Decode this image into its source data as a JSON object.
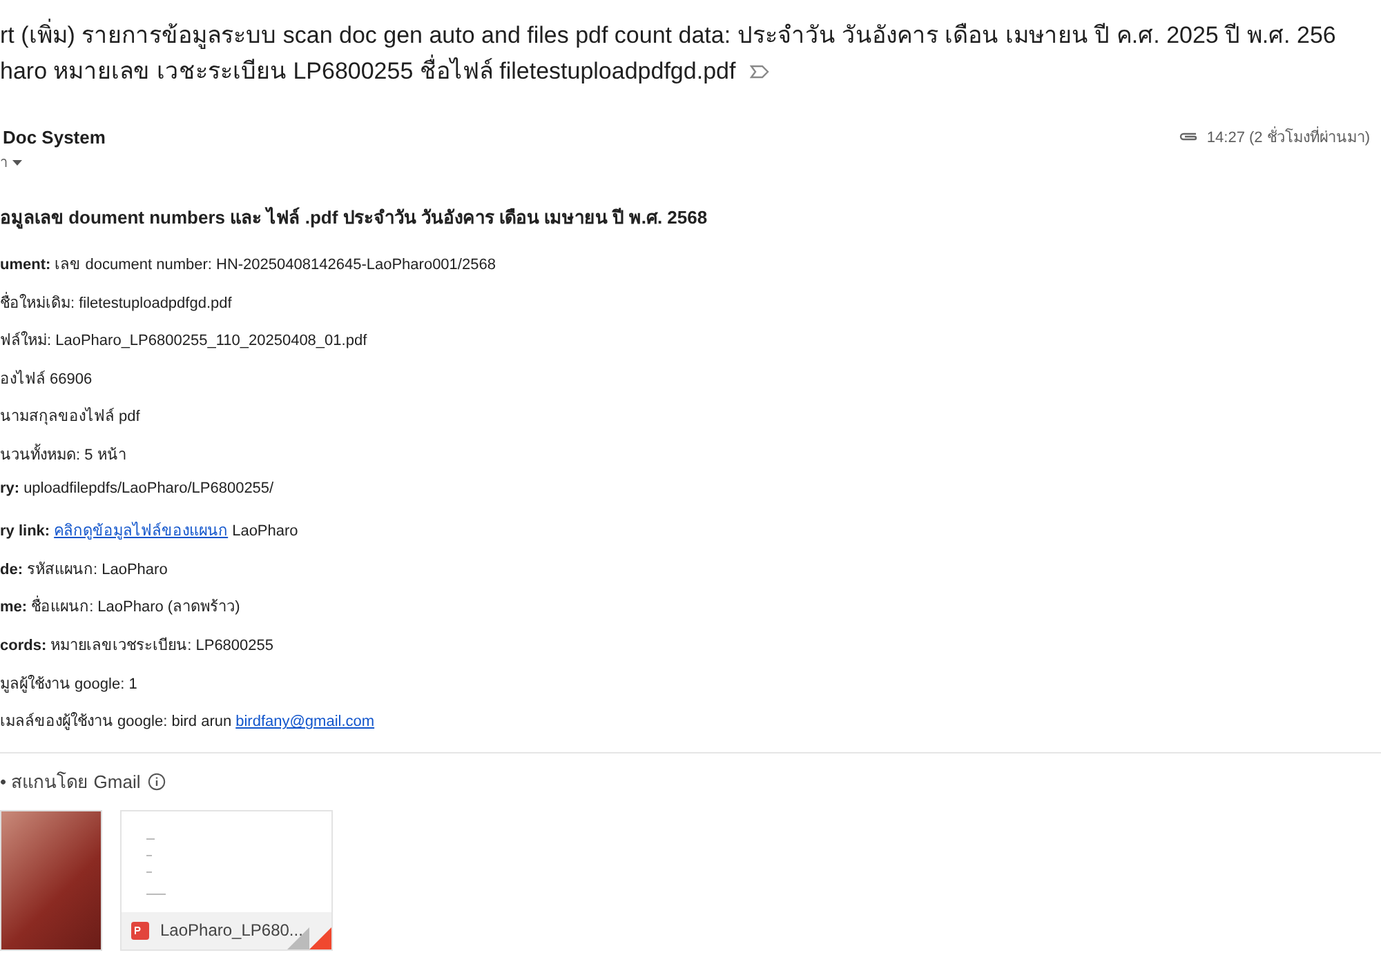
{
  "subject": {
    "lines": [
      "rt (เพิ่ม) รายการข้อมูลระบบ scan doc gen auto and files pdf count data: ประจำวัน วันอังคาร เดือน เมษายน ปี ค.ศ. 2025 ปี พ.ศ. 256",
      "haro หมายเลข เวชะระเบียน LP6800255 ชื่อไฟล์ filetestuploadpdfgd.pdf"
    ],
    "important": false
  },
  "sender": {
    "name": "Doc System",
    "recipient": "า"
  },
  "time": "14:27 (2 ชั่วโมงที่ผ่านมา)",
  "body": {
    "heading": "อมูลเลข doument numbers และ ไฟล์ .pdf ประจำวัน วันอังคาร เดือน เมษายน ปี พ.ศ. 2568",
    "rows": [
      {
        "label": "ument:",
        "value": "เลข document number: HN-20250408142645-LaoPharo001/2568"
      },
      {
        "value": "ชื่อใหม่เดิม: filetestuploadpdfgd.pdf"
      },
      {
        "value": "ฟล์ใหม่: LaoPharo_LP6800255_110_20250408_01.pdf"
      },
      {
        "value": "องไฟล์ 66906"
      },
      {
        "value": "นามสกุลของไฟล์ pdf"
      },
      {
        "value": "นวนทั้งหมด: 5 หน้า"
      },
      {
        "label": "ry:",
        "value": "uploadfilepdfs/LaoPharo/LP6800255/"
      },
      {
        "label": "ry link:",
        "link": "คลิกดูข้อมูลไฟล์ของแผนก",
        "after": "LaoPharo"
      },
      {
        "label": "de:",
        "value": "รหัสแผนก: LaoPharo"
      },
      {
        "label": "me:",
        "value": "ชื่อแผนก: LaoPharo (ลาดพร้าว)"
      },
      {
        "label": "cords:",
        "value": "หมายเลขเวชระเบียน: LP6800255"
      },
      {
        "value": "มูลผู้ใช้งาน google: 1"
      },
      {
        "value": "เมลล์ของผู้ใช้งาน google: bird arun",
        "link": "birdfany@gmail.com"
      }
    ]
  },
  "attachments": {
    "label": "• สแกนโดย Gmail",
    "items": [
      {
        "kind": "image"
      },
      {
        "kind": "pdf",
        "name": "LaoPharo_LP680..."
      }
    ]
  }
}
